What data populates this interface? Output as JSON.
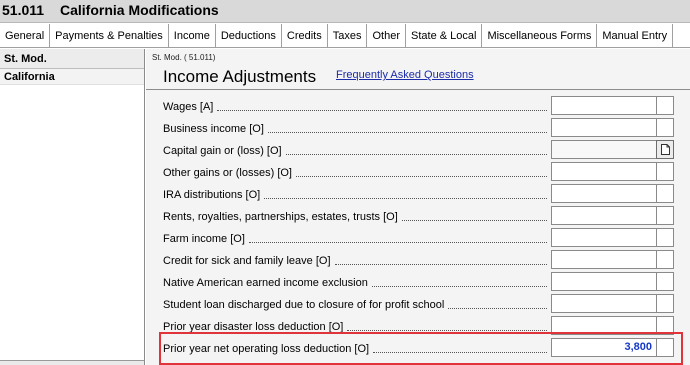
{
  "title": {
    "code": "51.011",
    "name": "California Modifications"
  },
  "tabs": [
    "General",
    "Payments & Penalties",
    "Income",
    "Deductions",
    "Credits",
    "Taxes",
    "Other",
    "State & Local",
    "Miscellaneous Forms",
    "Manual Entry"
  ],
  "left_panel": {
    "header": "St. Mod.",
    "items": [
      "California"
    ]
  },
  "form": {
    "code": "St. Mod. ( 51.011)",
    "title": "Income Adjustments",
    "faq_link": "Frequently Asked Questions",
    "rows": [
      {
        "label": "Wages [A]",
        "value": ""
      },
      {
        "label": "Business income [O]",
        "value": ""
      },
      {
        "label": "Capital gain or (loss) [O]",
        "value": ""
      },
      {
        "label": "Other gains or (losses) [O]",
        "value": ""
      },
      {
        "label": "IRA distributions [O]",
        "value": ""
      },
      {
        "label": "Rents, royalties, partnerships, estates, trusts [O]",
        "value": ""
      },
      {
        "label": "Farm income [O]",
        "value": ""
      },
      {
        "label": "Credit for sick and family leave [O]",
        "value": ""
      },
      {
        "label": "Native American earned income exclusion",
        "value": ""
      },
      {
        "label": "Student loan discharged due to closure of for profit school",
        "value": ""
      },
      {
        "label": "Prior year disaster loss deduction [O]",
        "value": ""
      },
      {
        "label": "Prior year net operating loss deduction [O]",
        "value": "3,800"
      }
    ]
  },
  "colors": {
    "value_text": "#1638c8",
    "highlight_border": "#e0343a",
    "link": "#1a2ca8"
  },
  "icons": {
    "detail_button": "document-icon"
  }
}
